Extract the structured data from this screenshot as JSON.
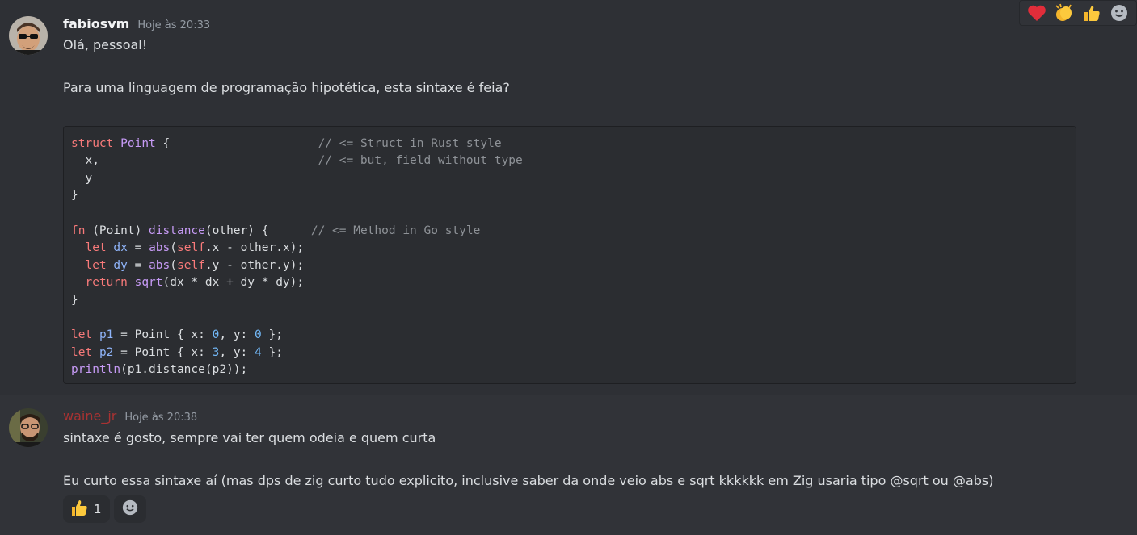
{
  "messages": [
    {
      "username": "fabiosvm",
      "timestamp": "Hoje às 20:33",
      "lines": [
        "Olá, pessoal!",
        "Para uma linguagem de programação hipotética, esta sintaxe é feia?"
      ],
      "code": [
        "struct Point {                     // <= Struct in Rust style",
        "  x,                               // <= but, field without type",
        "  y",
        "}",
        "",
        "fn (Point) distance(other) {      // <= Method in Go style",
        "  let dx = abs(self.x - other.x);",
        "  let dy = abs(self.y - other.y);",
        "  return sqrt(dx * dx + dy * dy);",
        "}",
        "",
        "let p1 = Point { x: 0, y: 0 };",
        "let p2 = Point { x: 3, y: 4 };",
        "println(p1.distance(p2));"
      ]
    },
    {
      "username": "waine_jr",
      "timestamp": "Hoje às 20:38",
      "lines": [
        "sintaxe é gosto, sempre vai ter quem odeia e quem curta",
        "Eu curto essa sintaxe aí (mas dps de zig curto tudo explicito, inclusive saber da onde veio abs e sqrt kkkkkk em Zig usaria tipo @sqrt ou @abs)"
      ],
      "reactions": [
        {
          "emoji": "thumbs-up-icon",
          "count": "1"
        },
        {
          "emoji": "add-reaction-icon"
        }
      ]
    }
  ],
  "hover_actions": [
    "heart-icon",
    "clapping-hands-icon",
    "thumbs-up-icon",
    "add-reaction-icon"
  ],
  "colors": {
    "background": "#313338",
    "code_bg": "#2b2d31",
    "username_red": "#a83232"
  }
}
